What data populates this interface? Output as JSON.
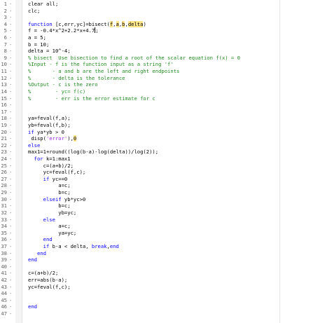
{
  "editor": {
    "lines": [
      {
        "n": "1",
        "segments": [
          {
            "t": "clear all;",
            "c": ""
          }
        ]
      },
      {
        "n": "2",
        "segments": [
          {
            "t": "clc;",
            "c": ""
          }
        ]
      },
      {
        "n": "3",
        "segments": []
      },
      {
        "n": "4",
        "segments": [
          {
            "t": "function",
            "c": "kw"
          },
          {
            "t": " [c,err,yc]=bisect(",
            "c": ""
          },
          {
            "t": "f",
            "c": "hl"
          },
          {
            "t": ",",
            "c": ""
          },
          {
            "t": "a",
            "c": "hl"
          },
          {
            "t": ",",
            "c": ""
          },
          {
            "t": "b",
            "c": "hl"
          },
          {
            "t": ",",
            "c": ""
          },
          {
            "t": "delta",
            "c": "hl"
          },
          {
            "t": ")",
            "c": ""
          }
        ]
      },
      {
        "n": "5",
        "segments": [
          {
            "t": "f = -0.4*x^2+2.2*x+4.7",
            "c": ""
          },
          {
            "t": "",
            "c": "cursor"
          },
          {
            "t": ";",
            "c": ""
          }
        ]
      },
      {
        "n": "6",
        "segments": [
          {
            "t": "a = 5;",
            "c": ""
          }
        ]
      },
      {
        "n": "7",
        "segments": [
          {
            "t": "b = 10;",
            "c": ""
          }
        ]
      },
      {
        "n": "8",
        "segments": [
          {
            "t": "delta = 10^-4;",
            "c": ""
          }
        ]
      },
      {
        "n": "9",
        "segments": [
          {
            "t": "% bisect  Use bisection to find a root of the scalar equation f(x) = 0",
            "c": "cm"
          }
        ]
      },
      {
        "n": "10",
        "segments": [
          {
            "t": "%Input - f is the function input as a string 'f'",
            "c": "cm"
          }
        ]
      },
      {
        "n": "11",
        "segments": [
          {
            "t": "%       - a and b are the left and right endpoints",
            "c": "cm"
          }
        ]
      },
      {
        "n": "12",
        "segments": [
          {
            "t": "%       - delta is the tolerance",
            "c": "cm"
          }
        ]
      },
      {
        "n": "13",
        "segments": [
          {
            "t": "%Output - c is the zero",
            "c": "cm"
          }
        ]
      },
      {
        "n": "14",
        "segments": [
          {
            "t": "%        - yc= f(c)",
            "c": "cm"
          }
        ]
      },
      {
        "n": "15",
        "segments": [
          {
            "t": "%        - err is the error estimate for c",
            "c": "cm"
          }
        ]
      },
      {
        "n": "16",
        "segments": []
      },
      {
        "n": "17",
        "segments": []
      },
      {
        "n": "18",
        "segments": [
          {
            "t": "ya=feval(f,a);",
            "c": ""
          }
        ]
      },
      {
        "n": "19",
        "segments": [
          {
            "t": "yb=feval(f,b);",
            "c": ""
          }
        ]
      },
      {
        "n": "20",
        "segments": [
          {
            "t": "if",
            "c": "kw"
          },
          {
            "t": " ya*yb > 0",
            "c": ""
          }
        ]
      },
      {
        "n": "21",
        "segments": [
          {
            "t": " disp(",
            "c": ""
          },
          {
            "t": "'error'",
            "c": "str"
          },
          {
            "t": "),",
            "c": ""
          },
          {
            "t": "0",
            "c": "hl"
          }
        ]
      },
      {
        "n": "22",
        "segments": [
          {
            "t": "else",
            "c": "kw"
          }
        ]
      },
      {
        "n": "23",
        "segments": [
          {
            "t": "max1=1+round((log(b-a)-log(delta))/log(2));",
            "c": ""
          }
        ]
      },
      {
        "n": "24",
        "segments": [
          {
            "t": "  ",
            "c": ""
          },
          {
            "t": "for",
            "c": "kw"
          },
          {
            "t": " k=1:max1",
            "c": ""
          }
        ]
      },
      {
        "n": "25",
        "segments": [
          {
            "t": "     c=(a+b)/2;",
            "c": ""
          }
        ]
      },
      {
        "n": "26",
        "segments": [
          {
            "t": "     yc=feval(f,c);",
            "c": ""
          }
        ]
      },
      {
        "n": "27",
        "segments": [
          {
            "t": "     ",
            "c": ""
          },
          {
            "t": "if",
            "c": "kw"
          },
          {
            "t": " yc==0",
            "c": ""
          }
        ]
      },
      {
        "n": "28",
        "segments": [
          {
            "t": "          a=c;",
            "c": ""
          }
        ]
      },
      {
        "n": "29",
        "segments": [
          {
            "t": "          b=c;",
            "c": ""
          }
        ]
      },
      {
        "n": "30",
        "segments": [
          {
            "t": "     ",
            "c": ""
          },
          {
            "t": "elseif",
            "c": "kw"
          },
          {
            "t": " yb*yc>0",
            "c": ""
          }
        ]
      },
      {
        "n": "31",
        "segments": [
          {
            "t": "          b=c;",
            "c": ""
          }
        ]
      },
      {
        "n": "32",
        "segments": [
          {
            "t": "          yb=yc;",
            "c": ""
          }
        ]
      },
      {
        "n": "33",
        "segments": [
          {
            "t": "     ",
            "c": ""
          },
          {
            "t": "else",
            "c": "kw"
          }
        ]
      },
      {
        "n": "34",
        "segments": [
          {
            "t": "          a=c;",
            "c": ""
          }
        ]
      },
      {
        "n": "35",
        "segments": [
          {
            "t": "          ya=yc;",
            "c": ""
          }
        ]
      },
      {
        "n": "36",
        "segments": [
          {
            "t": "     ",
            "c": ""
          },
          {
            "t": "end",
            "c": "kw"
          }
        ]
      },
      {
        "n": "37",
        "segments": [
          {
            "t": "     ",
            "c": ""
          },
          {
            "t": "if",
            "c": "kw"
          },
          {
            "t": " b-a < delta, ",
            "c": ""
          },
          {
            "t": "break",
            "c": "kw"
          },
          {
            "t": ",",
            "c": ""
          },
          {
            "t": "end",
            "c": "kw"
          }
        ]
      },
      {
        "n": "38",
        "segments": [
          {
            "t": "   ",
            "c": ""
          },
          {
            "t": "end",
            "c": "kw"
          }
        ]
      },
      {
        "n": "39",
        "segments": [
          {
            "t": "end",
            "c": "kw"
          }
        ]
      },
      {
        "n": "40",
        "segments": []
      },
      {
        "n": "41",
        "segments": [
          {
            "t": "c=(a+b)/2;",
            "c": ""
          }
        ]
      },
      {
        "n": "42",
        "segments": [
          {
            "t": "err=abs(b-a);",
            "c": ""
          }
        ]
      },
      {
        "n": "43",
        "segments": [
          {
            "t": "yc=feval(f,c);",
            "c": ""
          }
        ]
      },
      {
        "n": "44",
        "segments": []
      },
      {
        "n": "45",
        "segments": []
      },
      {
        "n": "46",
        "segments": [
          {
            "t": "end",
            "c": "kw"
          }
        ]
      },
      {
        "n": "47",
        "segments": []
      }
    ]
  }
}
